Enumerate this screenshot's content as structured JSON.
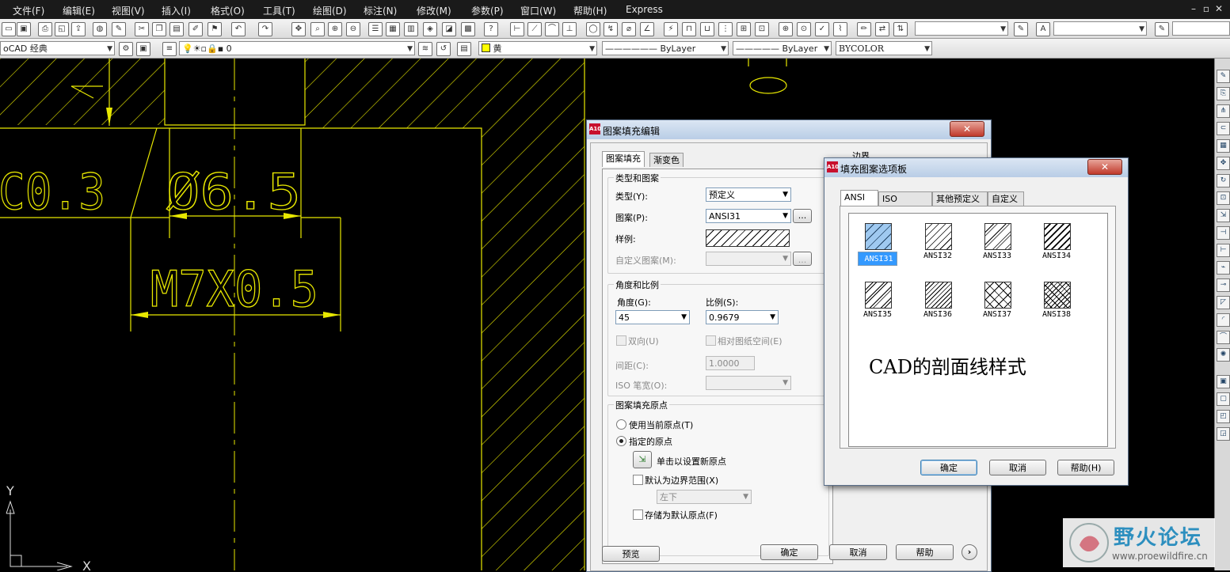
{
  "menu": [
    "文件(F)",
    "编辑(E)",
    "视图(V)",
    "插入(I)",
    "格式(O)",
    "工具(T)",
    "绘图(D)",
    "标注(N)",
    "修改(M)",
    "参数(P)",
    "窗口(W)",
    "帮助(H)",
    "Express"
  ],
  "toolbar2": {
    "workspace": "oCAD 经典",
    "layer": "0",
    "color": "黄",
    "linetype": "ByLayer",
    "lineweight": "ByLayer",
    "plotstyle": "BYCOLOR"
  },
  "drawing": {
    "dims": [
      "C0.3",
      "Ø6.5",
      "M7X0.5"
    ],
    "ucs_y": "Y",
    "ucs_x": "X",
    "colors": {
      "line": "#e8e800",
      "hatch": "#e8e800",
      "bg": "#000000"
    }
  },
  "hatch_dialog": {
    "title": "图案填充编辑",
    "close": "✕",
    "tabs": [
      "图案填充",
      "渐变色"
    ],
    "type_pattern_group": "类型和图案",
    "type_label": "类型(Y):",
    "type_value": "预定义",
    "pattern_label": "图案(P):",
    "pattern_value": "ANSI31",
    "browse": "...",
    "sample_label": "样例:",
    "custom_label": "自定义图案(M):",
    "angle_scale_group": "角度和比例",
    "angle_label": "角度(G):",
    "angle_value": "45",
    "scale_label": "比例(S):",
    "scale_value": "0.9679",
    "double_label": "双向(U)",
    "relative_label": "相对图纸空间(E)",
    "spacing_label": "间距(C):",
    "spacing_value": "1.0000",
    "iso_label": "ISO 笔宽(O):",
    "origin_group": "图案填充原点",
    "use_current": "使用当前原点(T)",
    "specified": "指定的原点",
    "click_set": "单击以设置新原点",
    "default_boundary": "默认为边界范围(X)",
    "position_value": "左下",
    "store_default": "存储为默认原点(F)",
    "boundary_label": "边界",
    "preview": "预览",
    "ok": "确定",
    "cancel": "取消",
    "help": "帮助",
    "more": "›"
  },
  "palette_dialog": {
    "title": "填充图案选项板",
    "close": "✕",
    "tabs": [
      "ANSI",
      "ISO",
      "其他预定义",
      "自定义"
    ],
    "patterns": [
      "ANSI31",
      "ANSI32",
      "ANSI33",
      "ANSI34",
      "ANSI35",
      "ANSI36",
      "ANSI37",
      "ANSI38"
    ],
    "selected": "ANSI31",
    "annotation": "CAD的剖面线样式",
    "ok": "确定",
    "cancel": "取消",
    "help": "帮助(H)"
  },
  "watermark": {
    "cn": "野火论坛",
    "url": "www.proewildfire.cn"
  }
}
